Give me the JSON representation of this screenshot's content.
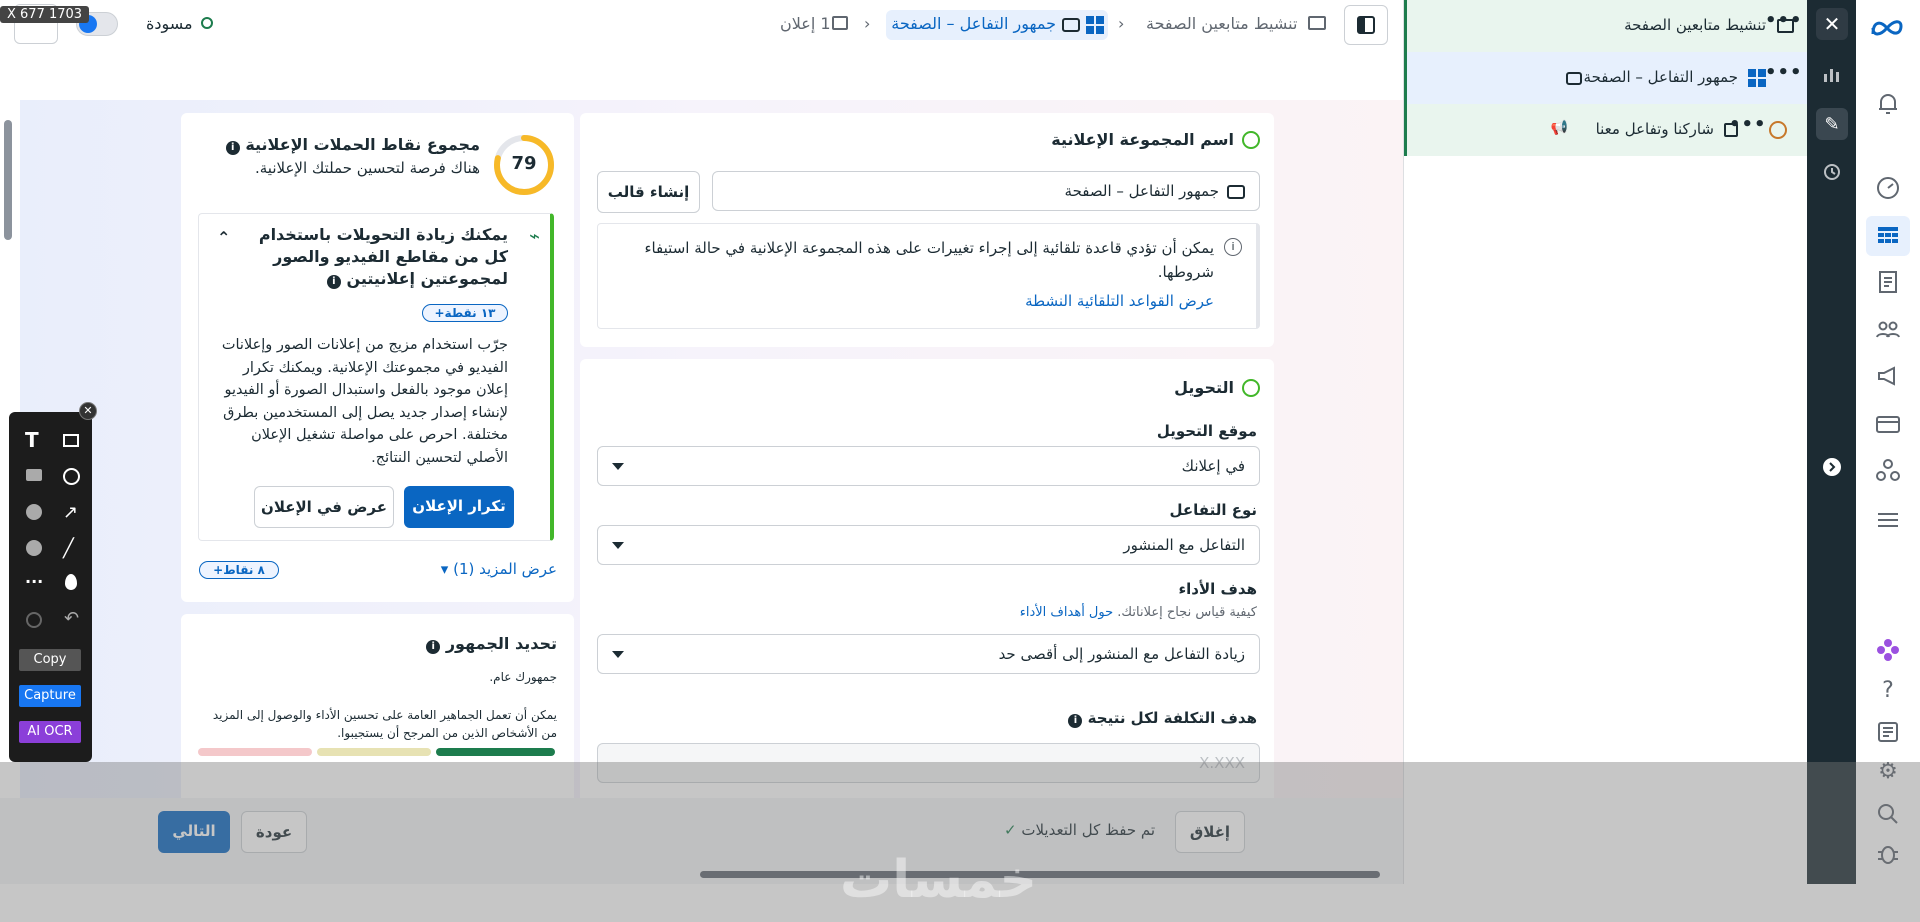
{
  "overlay": {
    "coord_label": "X 677 1703"
  },
  "topbar": {
    "status": "مسودة",
    "crumb_campaign": "تنشيط متابعين الصفحة",
    "crumb_adset": "جمهور التفاعل – الصفحة",
    "crumb_ads": "1 إعلان"
  },
  "adset_name_card": {
    "title": "اسم المجموعة الإعلانية",
    "value": "جمهور التفاعل – الصفحة",
    "template_button": "إنشاء قالب",
    "info_text": "يمكن أن تؤدي قاعدة تلقائية إلى إجراء تغييرات على هذه المجموعة الإعلانية في حالة استيفاء شروطها.",
    "rules_link": "عرض القواعد التلقائية النشطة"
  },
  "conversion_card": {
    "title": "التحويل",
    "location_label": "موقع التحويل",
    "location_value": "في إعلانك",
    "engagement_label": "نوع التفاعل",
    "engagement_value": "التفاعل مع المنشور",
    "goal_label": "هدف الأداء",
    "goal_help": "كيفية قياس نجاح إعلاناتك.",
    "goal_help_link": "حول أهداف الأداء",
    "goal_value": "زيادة التفاعل مع المنشور إلى أقصى حد",
    "cost_label": "هدف التكلفة لكل نتيجة",
    "cost_placeholder": "X.XXX"
  },
  "score_card": {
    "score": "79",
    "score_fraction": 0.79,
    "title": "مجموع نقاط الحملات الإعلانية",
    "subtitle": "هناك فرصة لتحسين حملتك الإعلانية.",
    "rec_title": "يمكنك زيادة التحويلات باستخدام كل من مقاطع الفيديو والصور لمجموعتين إعلانيتين",
    "rec_points": "+١٣ نقطة",
    "rec_body": "جرّب استخدام مزيج من إعلانات الصور وإعلانات الفيديو في مجموعتك الإعلانية. ويمكنك تكرار إعلان موجود بالفعل واستبدال الصورة أو الفيديو لإنشاء إصدار جديد يصل إلى المستخدمين بطرق مختلفة. احرص على مواصلة تشغيل الإعلان الأصلي لتحسين النتائج.",
    "duplicate_button": "تكرار الإعلان",
    "view_button": "عرض في الإعلان",
    "more_link": "عرض المزيد (1)",
    "more_points": "+٨ نقاط"
  },
  "audience_card": {
    "title": "تحديد الجمهور",
    "line1": "جمهورك عام.",
    "line2": "يمكن أن تعمل الجماهير العامة على تحسين الأداء والوصول إلى المزيد من الأشخاص الذين من المرجح أن يستجيبوا."
  },
  "footer": {
    "close_button": "إغلاق",
    "saved_text": "تم حفظ كل التعديلات",
    "back_button": "عودة",
    "next_button": "التالي"
  },
  "tree": {
    "campaign": "تنشيط متابعين الصفحة",
    "adset": "جمهور التفاعل – الصفحة",
    "ad": "شاركنا وتفاعل معنا"
  },
  "annotation_tool": {
    "copy": "Copy",
    "capture": "Capture",
    "ocr": "AI OCR"
  },
  "watermark": "خمسات",
  "colors": {
    "accent": "#0a66c2",
    "success": "#42b72a",
    "score_ring": "#f7b928",
    "dark_strip": "#1c2b33"
  }
}
